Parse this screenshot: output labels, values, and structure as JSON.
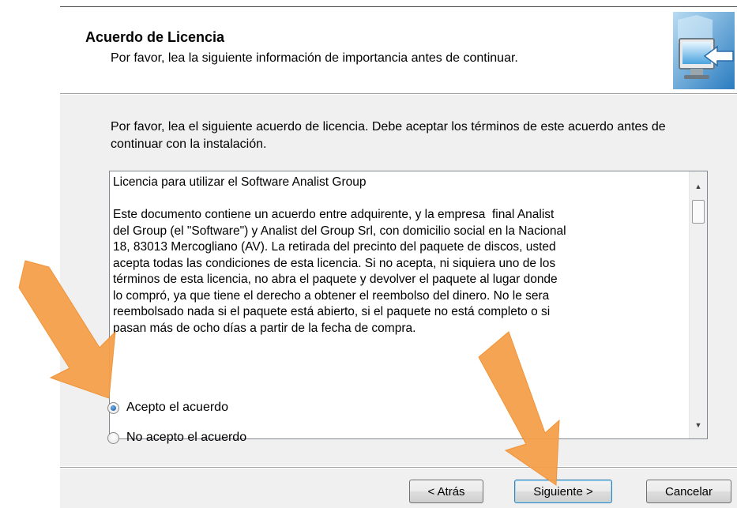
{
  "header": {
    "title": "Acuerdo de Licencia",
    "subtitle": "Por favor, lea la siguiente información de importancia antes de continuar.",
    "icon": "setup-computer-icon"
  },
  "instructions": "Por favor, lea el siguiente acuerdo de licencia. Debe aceptar los términos de este acuerdo antes de continuar con la instalación.",
  "license": {
    "heading": "Licencia para utilizar el Software Analist Group",
    "body": "Este documento contiene un acuerdo entre adquirente, y la empresa  final Analist\ndel Group (el \"Software\") y Analist del Group Srl, con domicilio social en la Nacional\n18, 83013 Mercogliano (AV). La retirada del precinto del paquete de discos, usted\nacepta todas las condiciones de esta licencia. Si no acepta, ni siquiera uno de los\ntérminos de esta licencia, no abra el paquete y devolver el paquete al lugar donde\nlo compró, ya que tiene el derecho a obtener el reembolso del dinero. No le sera\nreembolsado nada si el paquete está abierto, si el paquete no está completo o si\npasan más de ocho días a partir de la fecha de compra."
  },
  "options": [
    {
      "label": "Acepto el acuerdo",
      "checked": true
    },
    {
      "label": "No acepto el acuerdo",
      "checked": false
    }
  ],
  "buttons": {
    "back": "< Atrás",
    "next": "Siguiente >",
    "cancel": "Cancelar"
  },
  "colors": {
    "arrow": "#f5a04a",
    "dialog_bg": "#f0f0f0"
  }
}
